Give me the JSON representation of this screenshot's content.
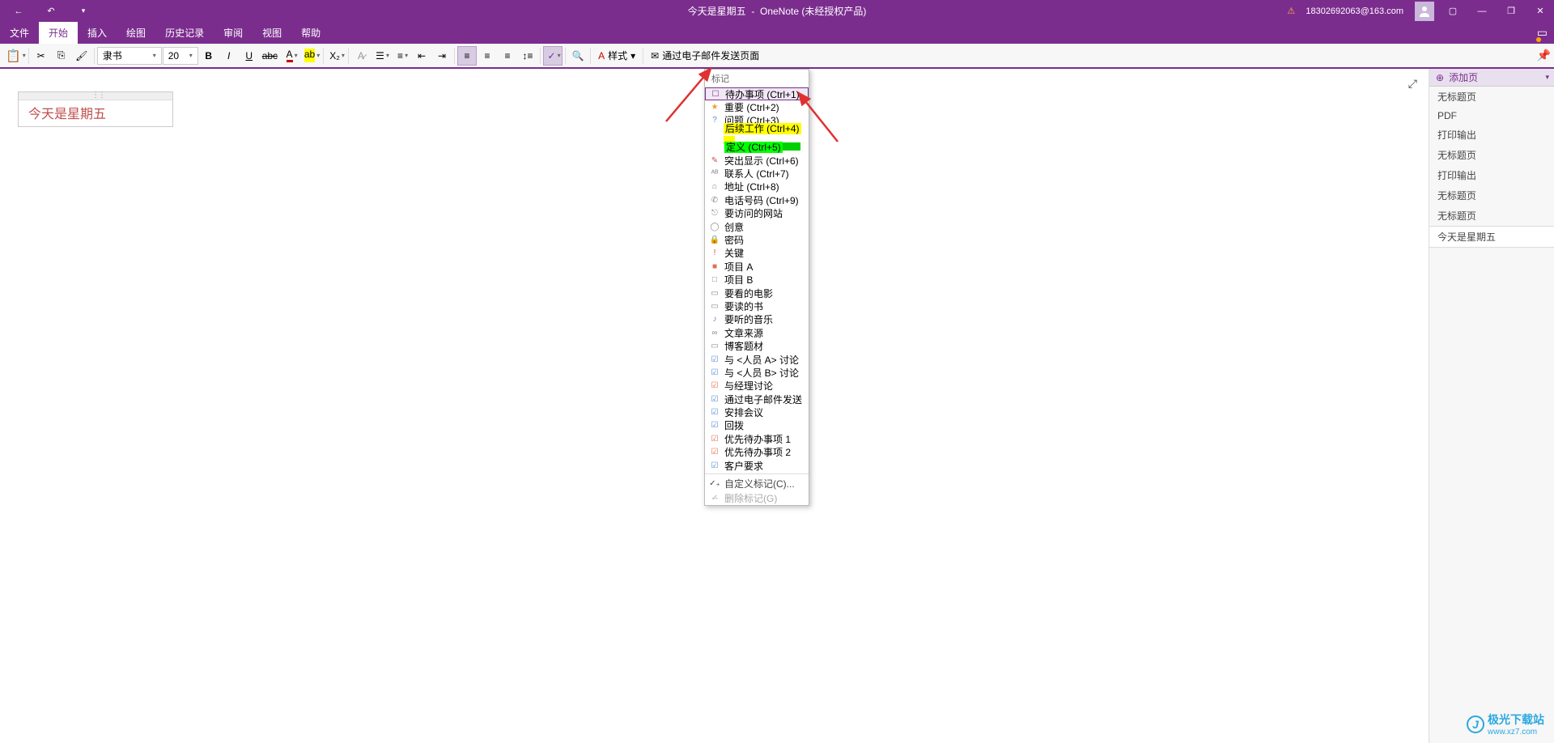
{
  "title_bar": {
    "document_title": "今天是星期五",
    "app_name": "OneNote (未经授权产品)",
    "user_email": "18302692063@163.com"
  },
  "menu": {
    "items": [
      "文件",
      "开始",
      "插入",
      "绘图",
      "历史记录",
      "审阅",
      "视图",
      "帮助"
    ],
    "active_index": 1
  },
  "ribbon": {
    "font_name": "隶书",
    "font_size": "20",
    "styles_label": "样式",
    "email_label": "通过电子邮件发送页面"
  },
  "note": {
    "text": "今天是星期五"
  },
  "page_panel": {
    "add_page": "添加页",
    "items": [
      "无标题页",
      "PDF",
      "打印输出",
      "无标题页",
      "打印输出",
      "无标题页",
      "无标题页",
      "今天是星期五"
    ],
    "selected_index": 7
  },
  "tag_menu": {
    "header": "标记",
    "items": [
      {
        "icon": "☐",
        "label": "待办事项 (Ctrl+1)",
        "color": "#7B2D8E",
        "hl": true
      },
      {
        "icon": "★",
        "label": "重要 (Ctrl+2)",
        "color": "#f0a030"
      },
      {
        "icon": "?",
        "label": "问题 (Ctrl+3)",
        "color": "#5b8bd0"
      },
      {
        "icon": "",
        "label": "后续工作 (Ctrl+4)",
        "mark": "yellow"
      },
      {
        "icon": "",
        "label": "定义 (Ctrl+5)",
        "mark": "green"
      },
      {
        "icon": "✎",
        "label": "突出显示 (Ctrl+6)",
        "color": "#d05050"
      },
      {
        "icon": "ᴬᴮ",
        "label": "联系人 (Ctrl+7)",
        "color": "#888"
      },
      {
        "icon": "⌂",
        "label": "地址 (Ctrl+8)",
        "color": "#888"
      },
      {
        "icon": "✆",
        "label": "电话号码 (Ctrl+9)",
        "color": "#888"
      },
      {
        "icon": "⎋",
        "label": "要访问的网站",
        "color": "#888"
      },
      {
        "icon": "◯",
        "label": "创意",
        "color": "#888"
      },
      {
        "icon": "🔒",
        "label": "密码",
        "color": "#888"
      },
      {
        "icon": "!",
        "label": "关键",
        "color": "#d05050"
      },
      {
        "icon": "■",
        "label": "项目 A",
        "color": "#e07050"
      },
      {
        "icon": "□",
        "label": "项目 B",
        "color": "#888"
      },
      {
        "icon": "▭",
        "label": "要看的电影",
        "color": "#888"
      },
      {
        "icon": "▭",
        "label": "要读的书",
        "color": "#888"
      },
      {
        "icon": "♪",
        "label": "要听的音乐",
        "color": "#5b8bd0"
      },
      {
        "icon": "∞",
        "label": "文章来源",
        "color": "#888"
      },
      {
        "icon": "▭",
        "label": "博客题材",
        "color": "#888"
      },
      {
        "icon": "☑",
        "label": "与 <人员 A> 讨论",
        "color": "#5b8bd0"
      },
      {
        "icon": "☑",
        "label": "与 <人员 B> 讨论",
        "color": "#5b8bd0"
      },
      {
        "icon": "☑",
        "label": "与经理讨论",
        "color": "#e07050"
      },
      {
        "icon": "☑",
        "label": "通过电子邮件发送",
        "color": "#5b8bd0"
      },
      {
        "icon": "☑",
        "label": "安排会议",
        "color": "#5b8bd0"
      },
      {
        "icon": "☑",
        "label": "回拨",
        "color": "#5b8bd0"
      },
      {
        "icon": "☑",
        "label": "优先待办事项 1",
        "color": "#e07050"
      },
      {
        "icon": "☑",
        "label": "优先待办事项 2",
        "color": "#e07050"
      },
      {
        "icon": "☑",
        "label": "客户要求",
        "color": "#5b8bd0"
      }
    ],
    "custom": "自定义标记(C)...",
    "remove": "删除标记(G)"
  },
  "watermark": {
    "brand": "极光下载站",
    "url": "www.xz7.com"
  }
}
